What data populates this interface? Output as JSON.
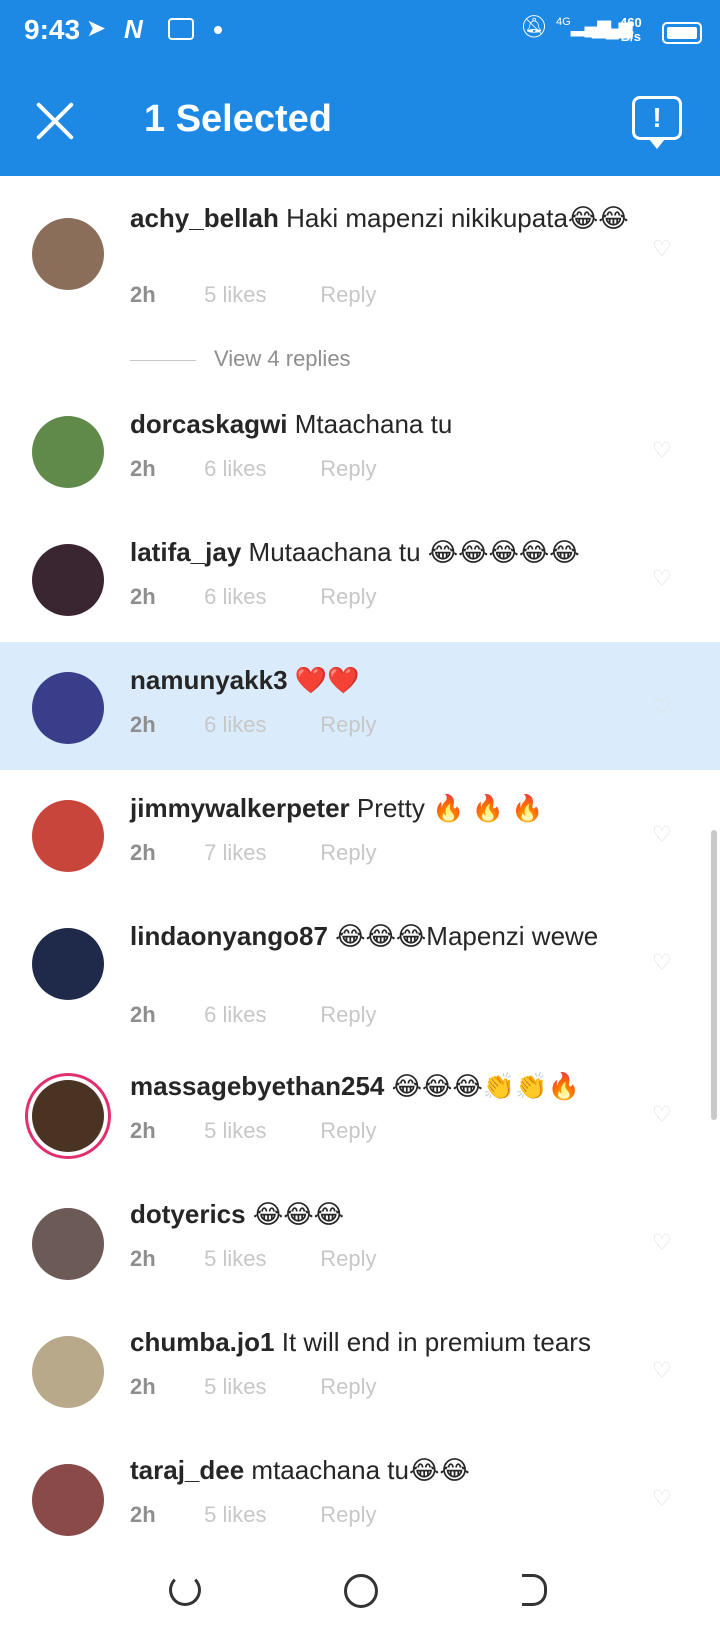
{
  "status_bar": {
    "time": "9:43",
    "network": "4G",
    "speed": "460\nB/s",
    "icons": [
      "telegram-icon",
      "n-app-icon",
      "message-icon",
      "dot-icon",
      "mute-icon",
      "signal-icon",
      "battery-icon"
    ]
  },
  "app_bar": {
    "title": "1 Selected",
    "report_icon_glyph": "!"
  },
  "colors": {
    "accent": "#1e88e5",
    "selected_row": "#daecfb",
    "meta_gray": "#c7c7c7"
  },
  "comments": [
    {
      "username": "achy_bellah",
      "text": "Haki mapenzi nikikupata😂😂",
      "time": "2h",
      "likes": "5 likes",
      "reply": "Reply",
      "view_replies": "View 4 replies",
      "avatar_color": "#8a6e5a"
    },
    {
      "username": "dorcaskagwi",
      "text": "Mtaachana tu",
      "time": "2h",
      "likes": "6 likes",
      "reply": "Reply",
      "avatar_color": "#5f8a4a"
    },
    {
      "username": "latifa_jay",
      "text": "Mutaachana tu 😂😂😂😂😂",
      "time": "2h",
      "likes": "6 likes",
      "reply": "Reply",
      "avatar_color": "#3a2630"
    },
    {
      "username": "namunyakk3",
      "text": "❤️❤️",
      "time": "2h",
      "likes": "6 likes",
      "reply": "Reply",
      "selected": true,
      "avatar_color": "#3a3e8a"
    },
    {
      "username": "jimmywalkerpeter",
      "text": "Pretty 🔥 🔥 🔥",
      "time": "2h",
      "likes": "7 likes",
      "reply": "Reply",
      "avatar_color": "#c7453a"
    },
    {
      "username": "lindaonyango87",
      "text": "😂😂😂Mapenzi wewe",
      "time": "2h",
      "likes": "6 likes",
      "reply": "Reply",
      "avatar_color": "#1f2a4a"
    },
    {
      "username": "massagebyethan254",
      "text": "😂😂😂👏👏🔥",
      "time": "2h",
      "likes": "5 likes",
      "reply": "Reply",
      "story": true,
      "avatar_color": "#4a3322"
    },
    {
      "username": "dotyerics",
      "text": "😂😂😂",
      "time": "2h",
      "likes": "5 likes",
      "reply": "Reply",
      "avatar_color": "#6b5a55"
    },
    {
      "username": "chumba.jo1",
      "text": "It will end in premium tears",
      "time": "2h",
      "likes": "5 likes",
      "reply": "Reply",
      "avatar_color": "#b8a98a"
    },
    {
      "username": "taraj_dee",
      "text": "mtaachana tu😂😂",
      "time": "2h",
      "likes": "5 likes",
      "reply": "Reply",
      "avatar_color": "#8a4a4a"
    }
  ],
  "nav_bar": {
    "buttons": [
      "recent-apps-icon",
      "home-icon",
      "back-icon"
    ]
  }
}
